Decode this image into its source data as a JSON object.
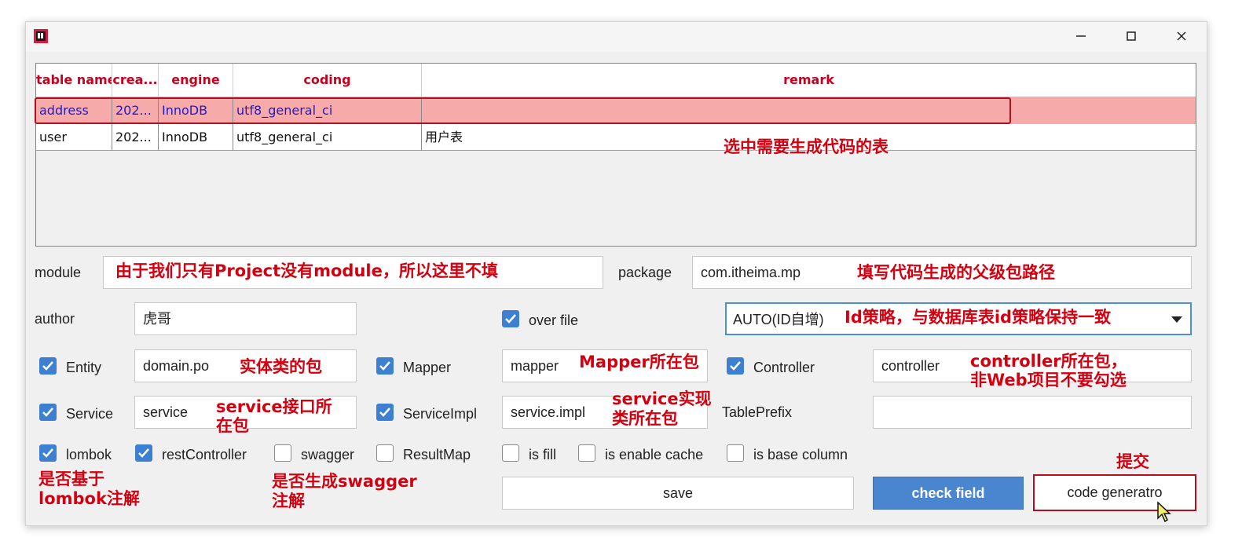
{
  "table": {
    "headers": [
      "table name",
      "crea...",
      "engine",
      "coding",
      "remark"
    ],
    "rows": [
      {
        "name": "address",
        "create": "202...",
        "engine": "InnoDB",
        "coding": "utf8_general_ci",
        "remark": ""
      },
      {
        "name": "user",
        "create": "202...",
        "engine": "InnoDB",
        "coding": "utf8_general_ci",
        "remark": "用户表"
      }
    ]
  },
  "form": {
    "module_label": "module",
    "module_value": "",
    "package_label": "package",
    "package_value": "com.itheima.mp",
    "author_label": "author",
    "author_value": "虎哥",
    "overfile_label": "over file",
    "overfile_checked": true,
    "id_strategy": "AUTO(ID自增)",
    "entity_label": "Entity",
    "entity_value": "domain.po",
    "mapper_label": "Mapper",
    "mapper_value": "mapper",
    "controller_label": "Controller",
    "controller_value": "controller",
    "service_label": "Service",
    "service_value": "service",
    "serviceimpl_label": "ServiceImpl",
    "serviceimpl_value": "service.impl",
    "tableprefix_label": "TablePrefix",
    "tableprefix_value": "",
    "options": {
      "lombok": "lombok",
      "restController": "restController",
      "swagger": "swagger",
      "resultMap": "ResultMap",
      "isFill": "is fill",
      "isEnableCache": "is enable cache",
      "isBaseColumn": "is base column"
    }
  },
  "buttons": {
    "save": "save",
    "check_field": "check field",
    "code_generator": "code generatro"
  },
  "annotations": {
    "select_table": "选中需要生成代码的表",
    "module_hint": "由于我们只有Project没有module，所以这里不填",
    "package_hint": "填写代码生成的父级包路径",
    "id_hint": "Id策略，与数据库表id策略保持一致",
    "entity_hint": "实体类的包",
    "mapper_hint": "Mapper所在包",
    "controller_hint_1": "controller所在包，",
    "controller_hint_2": "非Web项目不要勾选",
    "service_hint_1": "service接口所",
    "service_hint_2": "在包",
    "impl_hint_1": "service实现",
    "impl_hint_2": "类所在包",
    "lombok_hint_1": "是否基于",
    "lombok_hint_2": "lombok注解",
    "swagger_hint_1": "是否生成swagger",
    "swagger_hint_2": "注解",
    "submit_hint": "提交"
  },
  "colors": {
    "annotation": "#d4000f",
    "selected_row": "#f7aaaa",
    "accent": "#3d7fd1"
  }
}
